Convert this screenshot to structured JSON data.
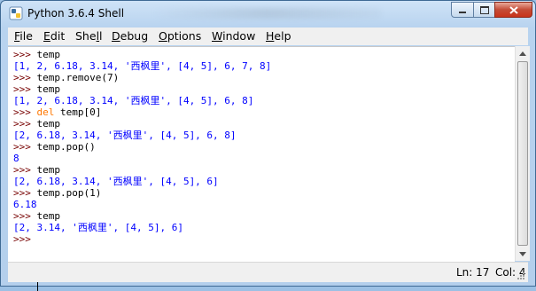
{
  "window": {
    "title": "Python 3.6.4 Shell"
  },
  "menu": [
    {
      "label": "File",
      "mnemonic": "F",
      "rest": "ile"
    },
    {
      "label": "Edit",
      "mnemonic": "E",
      "rest": "dit"
    },
    {
      "label": "Shell",
      "pre": "She",
      "mnemonic": "l",
      "rest": "l"
    },
    {
      "label": "Debug",
      "mnemonic": "D",
      "rest": "ebug"
    },
    {
      "label": "Options",
      "mnemonic": "O",
      "rest": "ptions"
    },
    {
      "label": "Window",
      "mnemonic": "W",
      "rest": "indow"
    },
    {
      "label": "Help",
      "mnemonic": "H",
      "rest": "elp"
    }
  ],
  "shell": {
    "prompt": ">>> ",
    "lines": [
      {
        "kind": "in",
        "text": "temp"
      },
      {
        "kind": "out",
        "text": "[1, 2, 6.18, 3.14, '西枫里', [4, 5], 6, 7, 8]"
      },
      {
        "kind": "in",
        "text": "temp.remove(7)"
      },
      {
        "kind": "in",
        "text": "temp"
      },
      {
        "kind": "out",
        "text": "[1, 2, 6.18, 3.14, '西枫里', [4, 5], 6, 8]"
      },
      {
        "kind": "in",
        "keyword": "del",
        "text": " temp[0]"
      },
      {
        "kind": "in",
        "text": "temp"
      },
      {
        "kind": "out",
        "text": "[2, 6.18, 3.14, '西枫里', [4, 5], 6, 8]"
      },
      {
        "kind": "in",
        "text": "temp.pop()"
      },
      {
        "kind": "out",
        "text": "8"
      },
      {
        "kind": "in",
        "text": "temp"
      },
      {
        "kind": "out",
        "text": "[2, 6.18, 3.14, '西枫里', [4, 5], 6]"
      },
      {
        "kind": "in",
        "text": "temp.pop(1)"
      },
      {
        "kind": "out",
        "text": "6.18"
      },
      {
        "kind": "in",
        "text": "temp"
      },
      {
        "kind": "out",
        "text": "[2, 3.14, '西枫里', [4, 5], 6]"
      },
      {
        "kind": "in",
        "text": ""
      }
    ]
  },
  "status": {
    "line": "Ln: 17",
    "col": "Col: 4"
  },
  "colors": {
    "prompt": "#770000",
    "output": "#0000ff",
    "keyword": "#ff7700",
    "close": "#c8331a"
  }
}
